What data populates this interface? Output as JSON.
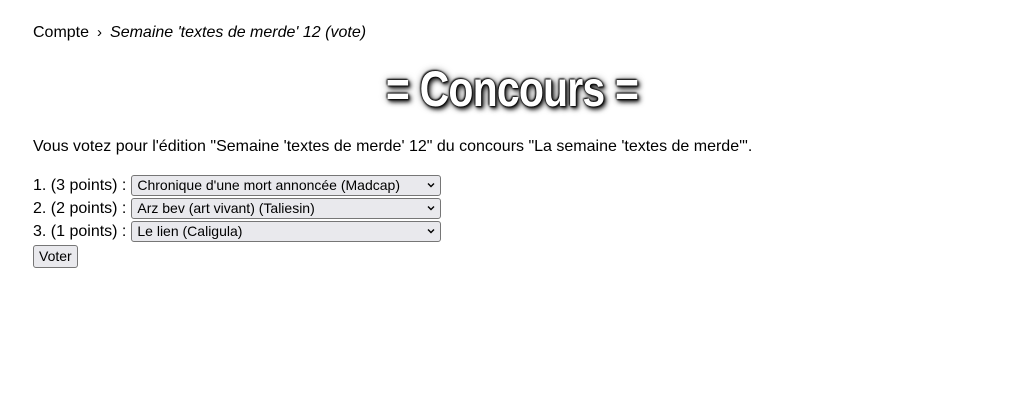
{
  "breadcrumb": {
    "home": "Compte",
    "separator": "›",
    "current": "Semaine 'textes de merde' 12 (vote)"
  },
  "title": "= Concours =",
  "intro": "Vous votez pour l'édition \"Semaine 'textes de merde' 12\" du concours \"La semaine 'textes de merde'\".",
  "votes": [
    {
      "label": "1. (3 points) :",
      "selected": "Chronique d'une mort annoncée (Madcap)"
    },
    {
      "label": "2. (2 points) :",
      "selected": "Arz bev (art vivant) (Taliesin)"
    },
    {
      "label": "3. (1 points) :",
      "selected": "Le lien (Caligula)"
    }
  ],
  "submit_label": "Voter"
}
